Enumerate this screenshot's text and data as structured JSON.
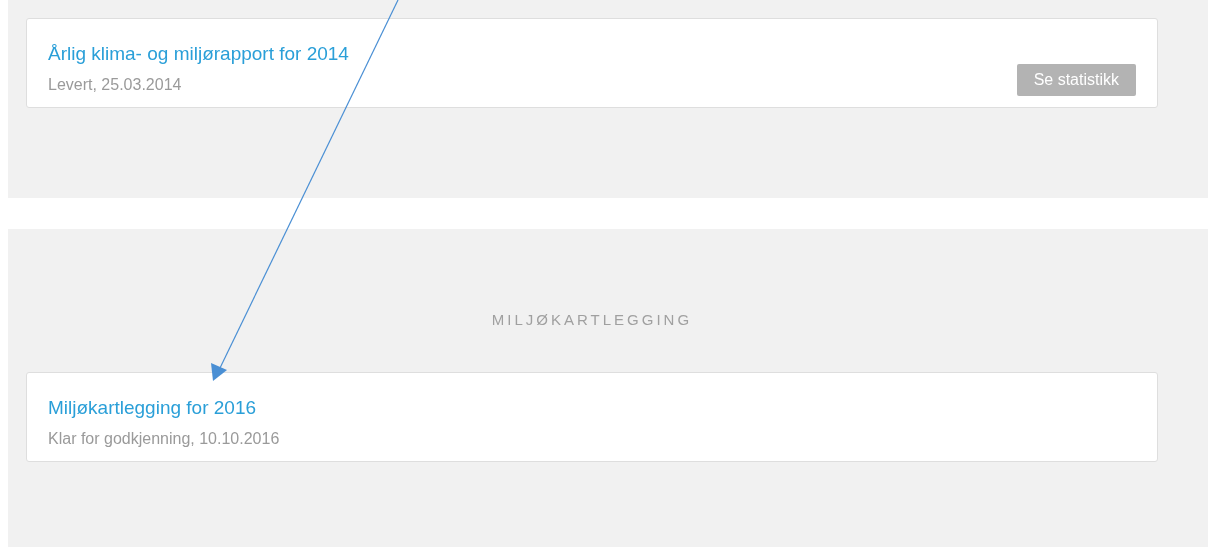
{
  "sections": [
    {
      "items": [
        {
          "title": "Årlig klima- og miljørapport for 2014",
          "status": "Levert, 25.03.2014",
          "button": "Se statistikk"
        }
      ]
    },
    {
      "heading": "MILJØKARTLEGGING",
      "items": [
        {
          "title": "Miljøkartlegging for 2016",
          "status": "Klar for godkjenning, 10.10.2016"
        }
      ]
    }
  ]
}
